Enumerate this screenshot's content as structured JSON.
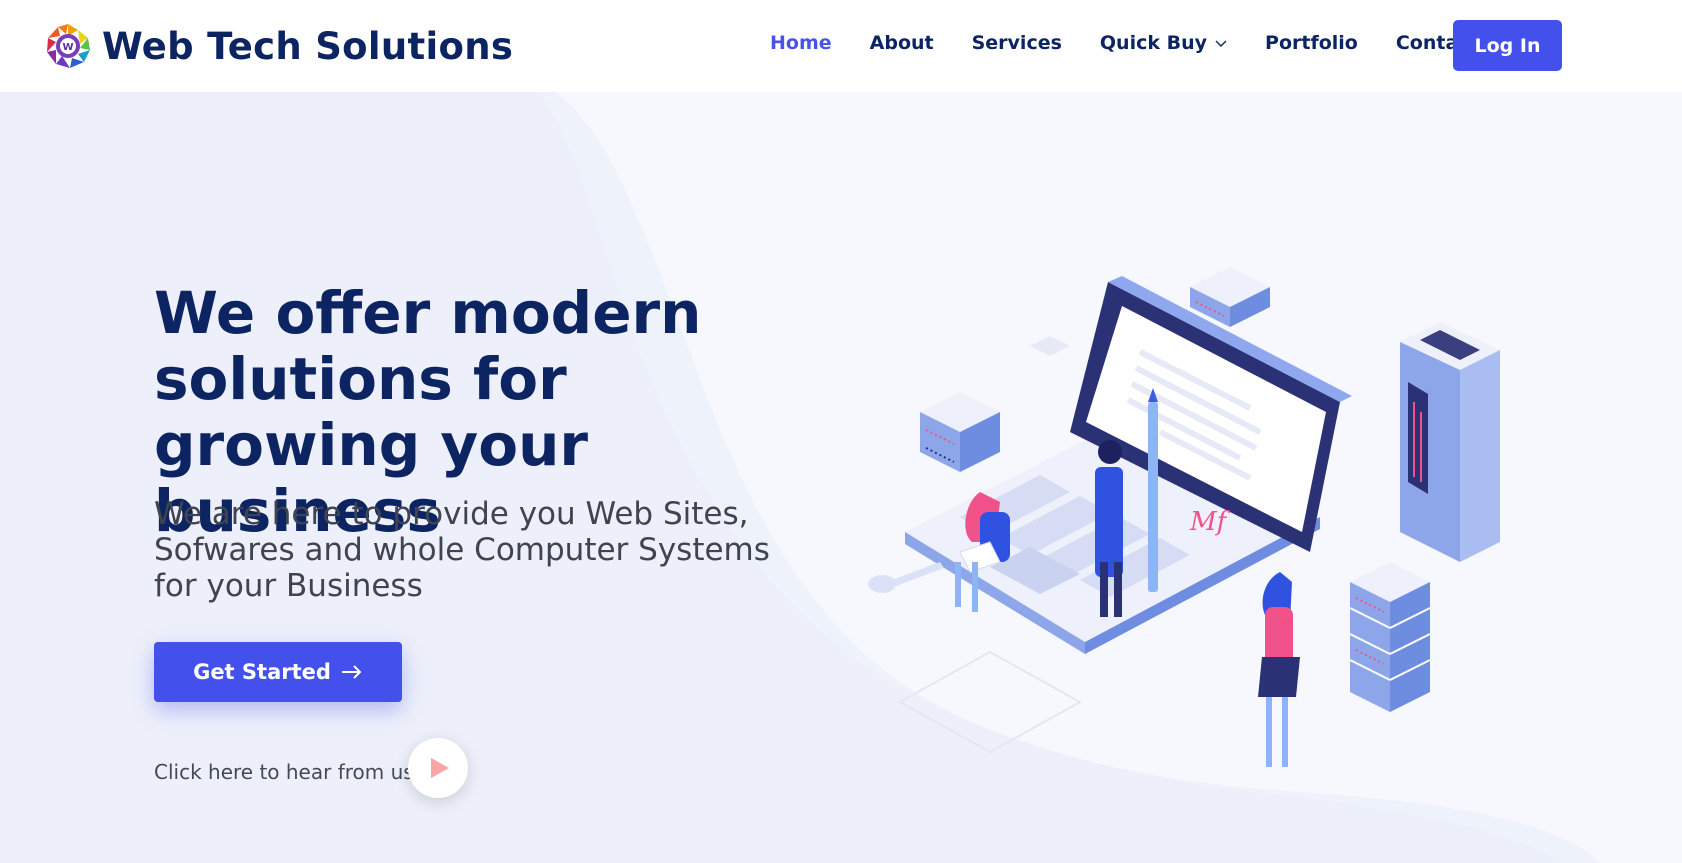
{
  "brand": {
    "name": "Web Tech Solutions",
    "logo_letter": "W"
  },
  "nav": {
    "items": [
      {
        "label": "Home",
        "active": true
      },
      {
        "label": "About",
        "active": false
      },
      {
        "label": "Services",
        "active": false
      },
      {
        "label": "Quick Buy",
        "active": false,
        "has_dropdown": true
      },
      {
        "label": "Portfolio",
        "active": false
      },
      {
        "label": "Contact",
        "active": false
      }
    ],
    "login_label": "Log In"
  },
  "hero": {
    "headline": "We offer modern solutions for growing your business",
    "subline": "We are here to provide you Web Sites, Sofwares and whole Computer Systems for your Business",
    "cta_label": "Get Started",
    "cta_icon": "arrow-right-icon",
    "hear_text": "Click here to hear from us",
    "play_icon": "play-icon",
    "signature_text": "Mf"
  },
  "colors": {
    "primary": "#4450eb",
    "navy": "#0d2463",
    "text_gray": "#3f4450",
    "hero_bg": "#f0f3fb",
    "accent_pink": "#f2528a"
  }
}
